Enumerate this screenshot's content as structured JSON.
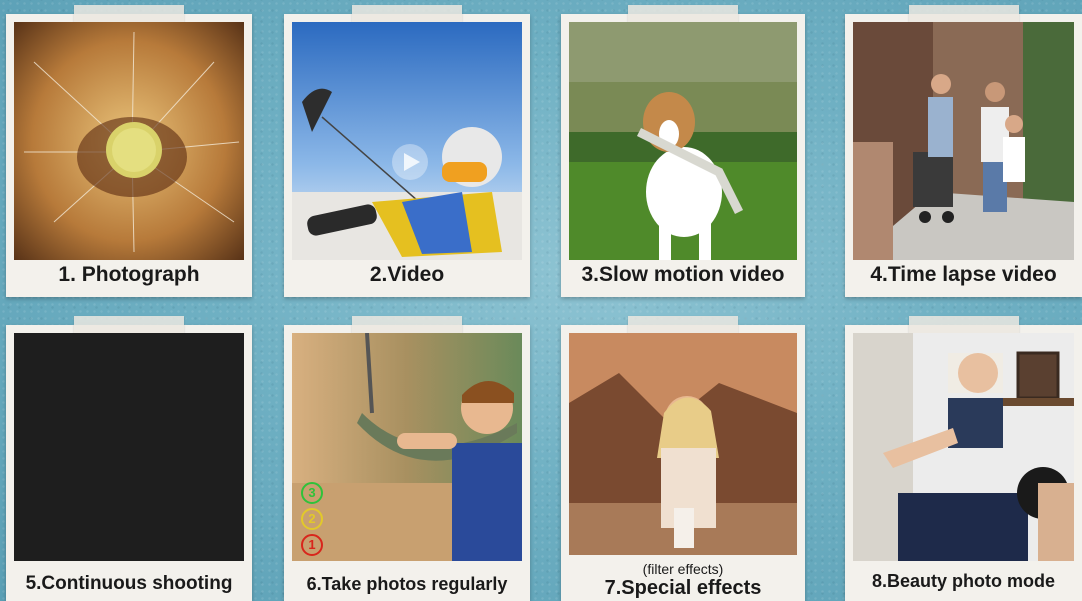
{
  "cards": [
    {
      "caption": "1. Photograph",
      "icon": "dandelion-photo"
    },
    {
      "caption": "2.Video",
      "icon": "snowkite-video"
    },
    {
      "caption": "3.Slow motion video",
      "icon": "dog-running"
    },
    {
      "caption": "4.Time lapse video",
      "icon": "family-walking"
    },
    {
      "caption": "5.Continuous shooting",
      "icon": "black-frame"
    },
    {
      "caption": "6.Take photos regularly",
      "icon": "boy-on-swing",
      "timer": [
        "3",
        "2",
        "1"
      ]
    },
    {
      "caption": "7.Special effects",
      "subcaption": "(filter effects)",
      "icon": "woman-filter"
    },
    {
      "caption": "8.Beauty photo mode",
      "icon": "father-baby"
    }
  ]
}
